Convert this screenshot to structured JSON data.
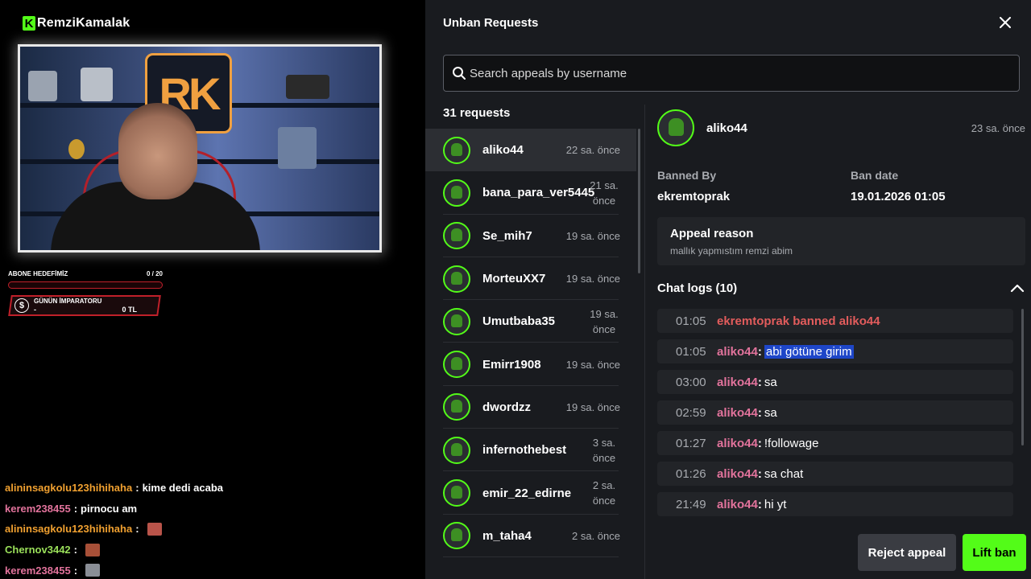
{
  "stream": {
    "channel_name": "RemziKamalak",
    "cam_logo": "RK",
    "goal": {
      "label": "ABONE HEDEFİMİZ",
      "progress": "0 / 20"
    },
    "emperor": {
      "title": "GÜNÜN İMPARATORU",
      "name": "-",
      "amount": "0 TL",
      "icon": "$"
    },
    "chat": [
      {
        "user": "alininsagkolu123hihihaha",
        "sep": ":",
        "message": "kime dedi acaba",
        "color": "#f0a030",
        "emote": null
      },
      {
        "user": "kerem238455",
        "sep": ":",
        "message": "pirnocu am",
        "color": "#e2739c",
        "emote": null
      },
      {
        "user": "alininsagkolu123hihihaha",
        "sep": ":",
        "message": "",
        "color": "#f0a030",
        "emote": "#b9544a"
      },
      {
        "user": "Chernov3442",
        "sep": ":",
        "message": "",
        "color": "#9ae05a",
        "emote": "#a85038"
      },
      {
        "user": "kerem238455",
        "sep": ":",
        "message": "",
        "color": "#e2739c",
        "emote": "#8a8e96"
      }
    ]
  },
  "panel": {
    "title": "Unban Requests",
    "close_icon": "close-icon",
    "search_placeholder": "Search appeals by username",
    "request_count": "31 requests",
    "accent_color": "#53fc18",
    "requests": [
      {
        "name": "aliko44",
        "time": "22 sa. önce",
        "active": true
      },
      {
        "name": "bana_para_ver5445",
        "time": "21 sa. önce",
        "active": false
      },
      {
        "name": "Se_mih7",
        "time": "19 sa. önce",
        "active": false
      },
      {
        "name": "MorteuXX7",
        "time": "19 sa. önce",
        "active": false
      },
      {
        "name": "Umutbaba35",
        "time": "19 sa. önce",
        "active": false
      },
      {
        "name": "Emirr1908",
        "time": "19 sa. önce",
        "active": false
      },
      {
        "name": "dwordzz",
        "time": "19 sa. önce",
        "active": false
      },
      {
        "name": "infernothebest",
        "time": "3 sa. önce",
        "active": false
      },
      {
        "name": "emir_22_edirne",
        "time": "2 sa. önce",
        "active": false
      },
      {
        "name": "m_taha4",
        "time": "2 sa. önce",
        "active": false
      }
    ],
    "detail": {
      "username": "aliko44",
      "time": "23 sa. önce",
      "banned_by_label": "Banned By",
      "banned_by": "ekremtoprak",
      "ban_date_label": "Ban date",
      "ban_date": "19.01.2026 01:05",
      "appeal_reason_label": "Appeal reason",
      "appeal_reason": "mallık yapmıstım remzi abim",
      "chat_logs_label": "Chat logs (10)",
      "logs": [
        {
          "time": "01:05",
          "type": "ban",
          "text": "ekremtoprak banned aliko44"
        },
        {
          "time": "01:05",
          "type": "msg",
          "user": "aliko44",
          "message": "abi götüne girim",
          "selected": true
        },
        {
          "time": "03:00",
          "type": "msg",
          "user": "aliko44",
          "message": "sa",
          "selected": false
        },
        {
          "time": "02:59",
          "type": "msg",
          "user": "aliko44",
          "message": "sa",
          "selected": false
        },
        {
          "time": "01:27",
          "type": "msg",
          "user": "aliko44",
          "message": "!followage",
          "selected": false
        },
        {
          "time": "01:26",
          "type": "msg",
          "user": "aliko44",
          "message": "sa chat",
          "selected": false
        },
        {
          "time": "21:49",
          "type": "msg",
          "user": "aliko44",
          "message": "hi yt",
          "selected": false
        }
      ]
    },
    "reject_label": "Reject appeal",
    "lift_label": "Lift ban"
  }
}
